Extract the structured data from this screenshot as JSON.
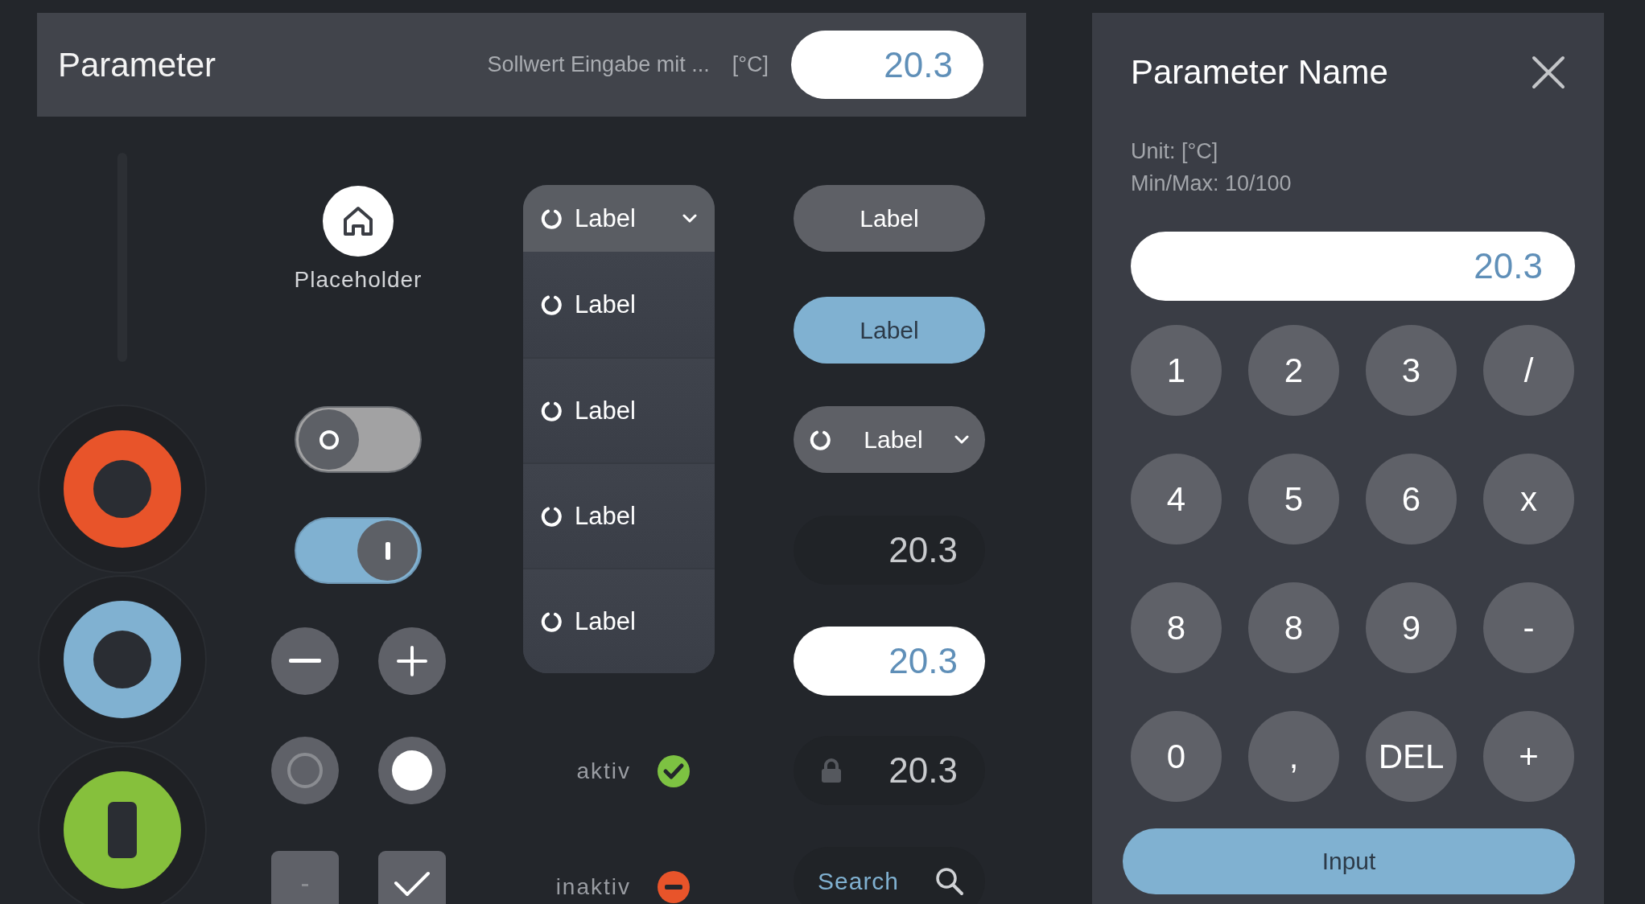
{
  "header": {
    "title": "Parameter",
    "description": "Sollwert Eingabe mit ...",
    "unit": "[°C]",
    "value": "20.3"
  },
  "slider": {
    "level": 0
  },
  "status_buttons": [
    {
      "kind": "ring",
      "color": "#e8542a"
    },
    {
      "kind": "ring",
      "color": "#80b1d1"
    },
    {
      "kind": "bar",
      "color": "#86c03c"
    }
  ],
  "home_button": {
    "label": "Placeholder"
  },
  "toggles": [
    {
      "on": false
    },
    {
      "on": true
    }
  ],
  "radios": [
    {
      "selected": false
    },
    {
      "selected": true
    }
  ],
  "checkboxes": [
    {
      "checked": false
    },
    {
      "checked": true
    }
  ],
  "dropdown": {
    "label": "Label",
    "expanded": true,
    "options": [
      {
        "label": "Label"
      },
      {
        "label": "Label"
      },
      {
        "label": "Label"
      },
      {
        "label": "Label"
      }
    ]
  },
  "status_items": [
    {
      "label": "aktiv",
      "kind": "ok",
      "color": "#7dc242"
    },
    {
      "label": "inaktiv",
      "kind": "error",
      "color": "#e8542a"
    }
  ],
  "buttons": [
    {
      "label": "Label",
      "kind": "secondary"
    },
    {
      "label": "Label",
      "kind": "primary"
    }
  ],
  "select": {
    "label": "Label",
    "expanded": false
  },
  "fields": [
    {
      "value": "20.3",
      "kind": "readonly"
    },
    {
      "value": "20.3",
      "kind": "input"
    },
    {
      "value": "20.3",
      "kind": "locked"
    }
  ],
  "search": {
    "placeholder": "Search"
  },
  "dialog": {
    "title": "Parameter Name",
    "unit": "Unit: [°C]",
    "range": "Min/Max: 10/100",
    "value": "20.3",
    "keys": [
      "1",
      "2",
      "3",
      "/",
      "4",
      "5",
      "6",
      "x",
      "8",
      "8",
      "9",
      "-",
      "0",
      ",",
      "DEL",
      "+"
    ],
    "submit": "Input"
  }
}
